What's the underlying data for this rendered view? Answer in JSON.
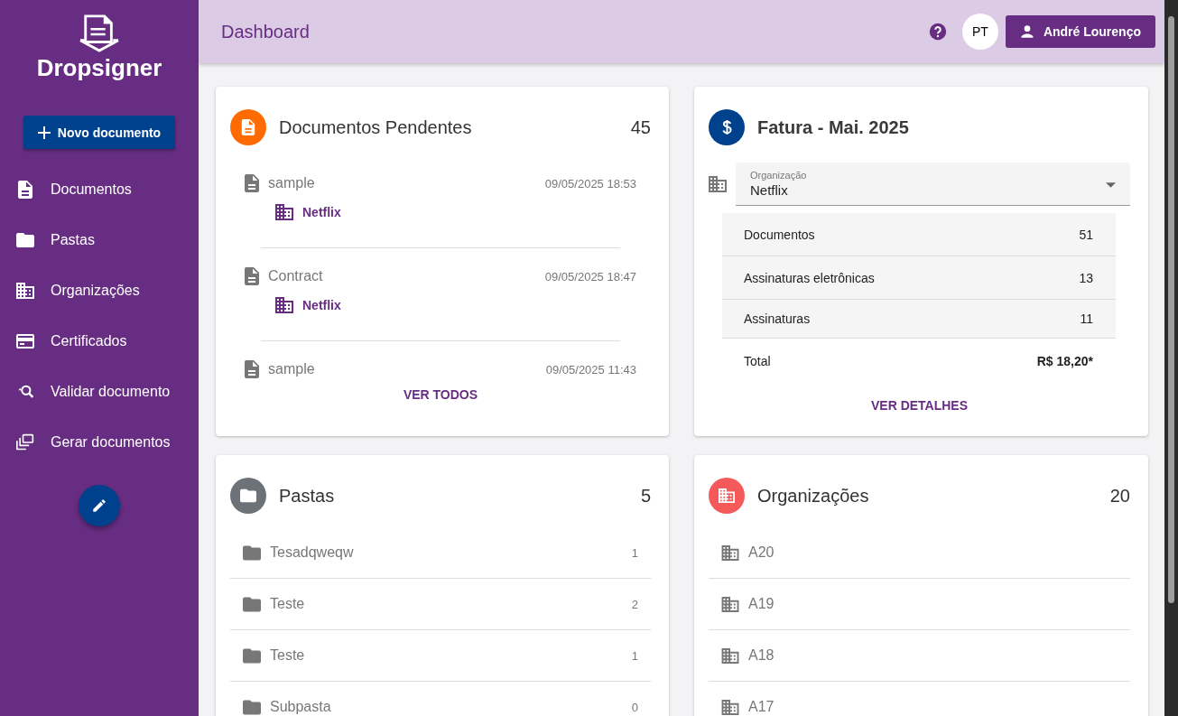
{
  "sidebar": {
    "logo": "Dropsigner",
    "new_button": "Novo documento",
    "items": [
      {
        "label": "Documentos",
        "kind": "document"
      },
      {
        "label": "Pastas",
        "kind": "folder"
      },
      {
        "label": "Organizações",
        "kind": "building"
      },
      {
        "label": "Certificados",
        "kind": "card"
      },
      {
        "label": "Validar documento",
        "kind": "search"
      },
      {
        "label": "Gerar documentos",
        "kind": "stack"
      }
    ]
  },
  "header": {
    "title": "Dashboard",
    "language": "PT",
    "user": "André Lourenço"
  },
  "pending": {
    "title": "Documentos Pendentes",
    "count": "45",
    "action": "VER TODOS",
    "items": [
      {
        "name": "sample",
        "date": "09/05/2025 18:53",
        "organization": "Netflix"
      },
      {
        "name": "Contract",
        "date": "09/05/2025 18:47",
        "organization": "Netflix"
      },
      {
        "name": "sample",
        "date": "09/05/2025 11:43"
      }
    ]
  },
  "invoice": {
    "title": "Fatura - Mai. 2025",
    "field_label": "Organização",
    "field_value": "Netflix",
    "rows": [
      {
        "label": "Documentos",
        "value": "51"
      },
      {
        "label": "Assinaturas eletrônicas",
        "value": "13"
      },
      {
        "label": "Assinaturas",
        "value": "11"
      }
    ],
    "total_label": "Total",
    "total_value": "R$ 18,20*",
    "action": "VER DETALHES"
  },
  "folders": {
    "title": "Pastas",
    "count": "5",
    "items": [
      {
        "name": "Tesadqweqw",
        "count": "1"
      },
      {
        "name": "Teste",
        "count": "2"
      },
      {
        "name": "Teste",
        "count": "1"
      },
      {
        "name": "Subpasta",
        "count": "0"
      }
    ]
  },
  "organizations": {
    "title": "Organizações",
    "count": "20",
    "items": [
      {
        "name": "A20"
      },
      {
        "name": "A19"
      },
      {
        "name": "A18"
      },
      {
        "name": "A17"
      }
    ]
  }
}
